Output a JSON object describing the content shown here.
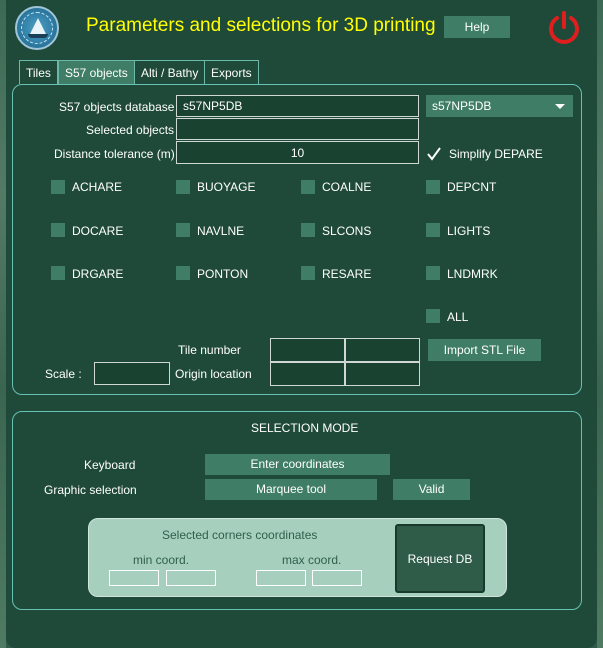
{
  "header": {
    "title": "Parameters and selections for 3D printing",
    "help_label": "Help"
  },
  "tabs": [
    {
      "label": "Tiles",
      "active": false
    },
    {
      "label": "S57 objects",
      "active": true
    },
    {
      "label": "Alti / Bathy",
      "active": false
    },
    {
      "label": "Exports",
      "active": false
    }
  ],
  "s57": {
    "database_label": "S57 objects database",
    "database_value": "s57NP5DB",
    "database_select": "s57NP5DB",
    "selected_objects_label": "Selected objects",
    "selected_objects_value": "",
    "distance_label": "Distance tolerance (m)",
    "distance_value": "10",
    "simplify_label": "Simplify DEPARE",
    "simplify_checked": true,
    "objects": [
      "ACHARE",
      "BUOYAGE",
      "COALNE",
      "DEPCNT",
      "DOCARE",
      "NAVLNE",
      "SLCONS",
      "LIGHTS",
      "DRGARE",
      "PONTON",
      "RESARE",
      "LNDMRK"
    ],
    "all_label": "ALL",
    "tile_number_label": "Tile number",
    "tile_number_values": [
      "",
      ""
    ],
    "import_label": "Import STL File",
    "scale_label": "Scale :",
    "scale_value": "",
    "origin_label": "Origin location",
    "origin_values": [
      "",
      ""
    ]
  },
  "selection": {
    "title": "SELECTION MODE",
    "keyboard_label": "Keyboard",
    "enter_coords_label": "Enter coordinates",
    "graphic_label": "Graphic selection",
    "marquee_label": "Marquee tool",
    "valid_label": "Valid",
    "corners_title": "Selected corners coordinates",
    "min_label": "min coord.",
    "max_label": "max coord.",
    "min_values": [
      "",
      ""
    ],
    "max_values": [
      "",
      ""
    ],
    "request_label": "Request DB"
  },
  "colors": {
    "background": "#1f4a39",
    "accent": "#3f7d66",
    "title": "#ffff00",
    "border": "#69c0b5",
    "power": "#e01e1e"
  },
  "icons": {
    "logo": "app-logo-icon",
    "power": "power-icon",
    "dropdown": "chevron-down-icon",
    "check": "checkmark-icon"
  }
}
